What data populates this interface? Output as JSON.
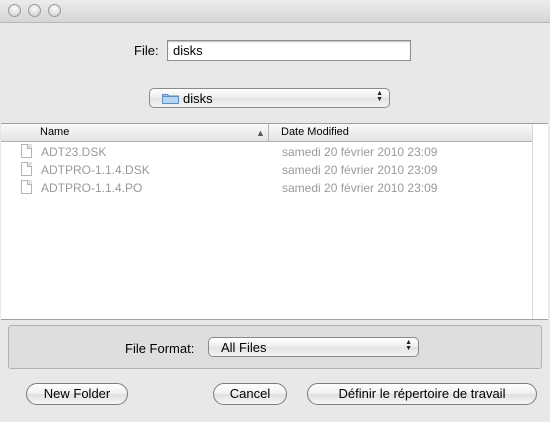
{
  "dialog": {
    "file_label": "File:",
    "file_value": "disks"
  },
  "location": {
    "folder_name": "disks",
    "folder_icon": "folder-icon"
  },
  "browser": {
    "columns": [
      "Name",
      "Date Modified"
    ],
    "files": [
      {
        "name": "ADT23.DSK",
        "date": "samedi 20 février 2010 23:09"
      },
      {
        "name": "ADTPRO-1.1.4.DSK",
        "date": "samedi 20 février 2010 23:09"
      },
      {
        "name": "ADTPRO-1.1.4.PO",
        "date": "samedi 20 février 2010 23:09"
      }
    ]
  },
  "format": {
    "label": "File Format:",
    "value": "All Files"
  },
  "buttons": {
    "new_folder": "New Folder",
    "cancel": "Cancel",
    "confirm": "Définir le répertoire de travail"
  },
  "colors": {
    "disabled_text": "#9a9a9a",
    "window_bg": "#e8e8e8"
  }
}
